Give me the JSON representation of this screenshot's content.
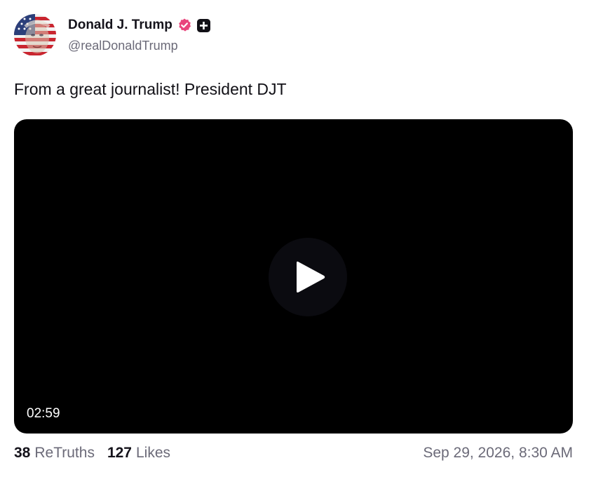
{
  "author": {
    "display_name": "Donald J. Trump",
    "handle": "@realDonaldTrump",
    "avatar_icon": "flag-portrait-avatar",
    "verified_icon": "verified-badge-icon",
    "verified_color": "#e9457c",
    "plus_icon": "plus-badge-icon"
  },
  "post": {
    "text": "From a great journalist! President DJT"
  },
  "video": {
    "duration": "02:59",
    "play_icon": "play-icon",
    "background": "#000000"
  },
  "stats": {
    "retruths_count": "38",
    "retruths_label": "ReTruths",
    "likes_count": "127",
    "likes_label": "Likes"
  },
  "timestamp": "Sep 29, 2026, 8:30 AM"
}
